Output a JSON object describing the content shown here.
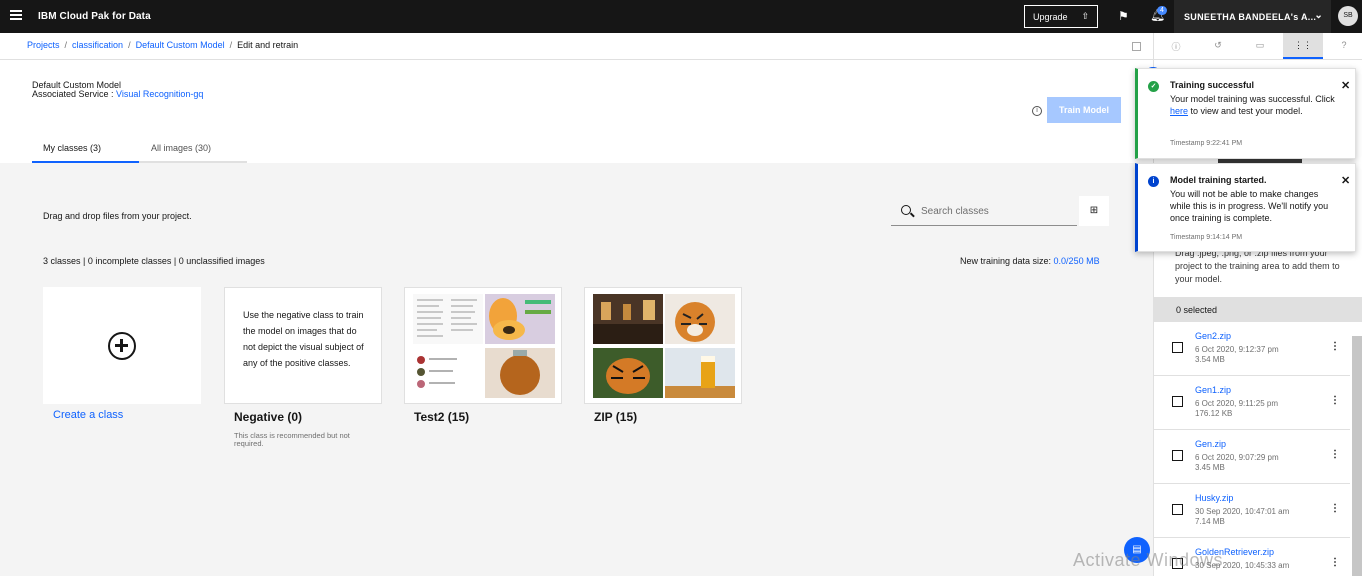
{
  "app": {
    "brand": "IBM Cloud Pak for Data",
    "upgrade_label": "Upgrade",
    "notification_count": "4",
    "account_name": "SUNEETHA BANDEELA's A...",
    "avatar_initials": "SB"
  },
  "breadcrumb": {
    "items": [
      "Projects",
      "classification",
      "Default Custom Model"
    ],
    "current": "Edit and retrain"
  },
  "header": {
    "model_name": "Default Custom Model",
    "service_label": "Associated Service : ",
    "service_link": "Visual Recognition-gq",
    "train_button": "Train Model"
  },
  "tabs": [
    {
      "label": "My classes (3)"
    },
    {
      "label": "All images (30)"
    }
  ],
  "content": {
    "drag_text": "Drag and drop files from your project.",
    "search_placeholder": "Search classes",
    "stats": "3 classes | 0 incomplete classes | 0 unclassified images",
    "datasize_label": "New training data size: ",
    "datasize_value": "0.0/250 MB"
  },
  "cards": {
    "create_label": "Create a class",
    "negative_desc": "Use the negative class to train the model on images that do not depict the visual subject of any of the positive classes.",
    "negative_title": "Negative (0)",
    "negative_sub": "This class is recommended but not required.",
    "test2_title": "Test2 (15)",
    "zip_title": "ZIP (15)"
  },
  "right_panel": {
    "hint": "Drag .jpeg, .png, or .zip files from your project to the training area to add them to your model.",
    "selected": "0 selected",
    "files": [
      {
        "name": "Gen2.zip",
        "date": "6 Oct 2020, 9:12:37 pm",
        "size": "3.54 MB"
      },
      {
        "name": "Gen1.zip",
        "date": "6 Oct 2020, 9:11:25 pm",
        "size": "176.12 KB"
      },
      {
        "name": "Gen.zip",
        "date": "6 Oct 2020, 9:07:29 pm",
        "size": "3.45 MB"
      },
      {
        "name": "Husky.zip",
        "date": "30 Sep 2020, 10:47:01 am",
        "size": "7.14 MB"
      },
      {
        "name": "GoldenRetriever.zip",
        "date": "30 Sep 2020, 10:45:33 am",
        "size": ""
      }
    ]
  },
  "toasts": {
    "success": {
      "title": "Training successful",
      "body_before": "Your model training was successful. Click ",
      "link": "here",
      "body_after": " to view and test your model.",
      "timestamp": "Timestamp 9:22:41 PM"
    },
    "info": {
      "title": "Model training started.",
      "body": "You will not be able to make changes while this is in progress. We'll notify you once training is complete.",
      "timestamp": "Timestamp 9:14:14 PM"
    }
  },
  "watermark": "Activate Windows",
  "colors": {
    "topbar": "#161616",
    "link": "#0f62fe",
    "success": "#24a148",
    "info": "#0043ce",
    "train_button_disabled": "#a6c8ff"
  }
}
